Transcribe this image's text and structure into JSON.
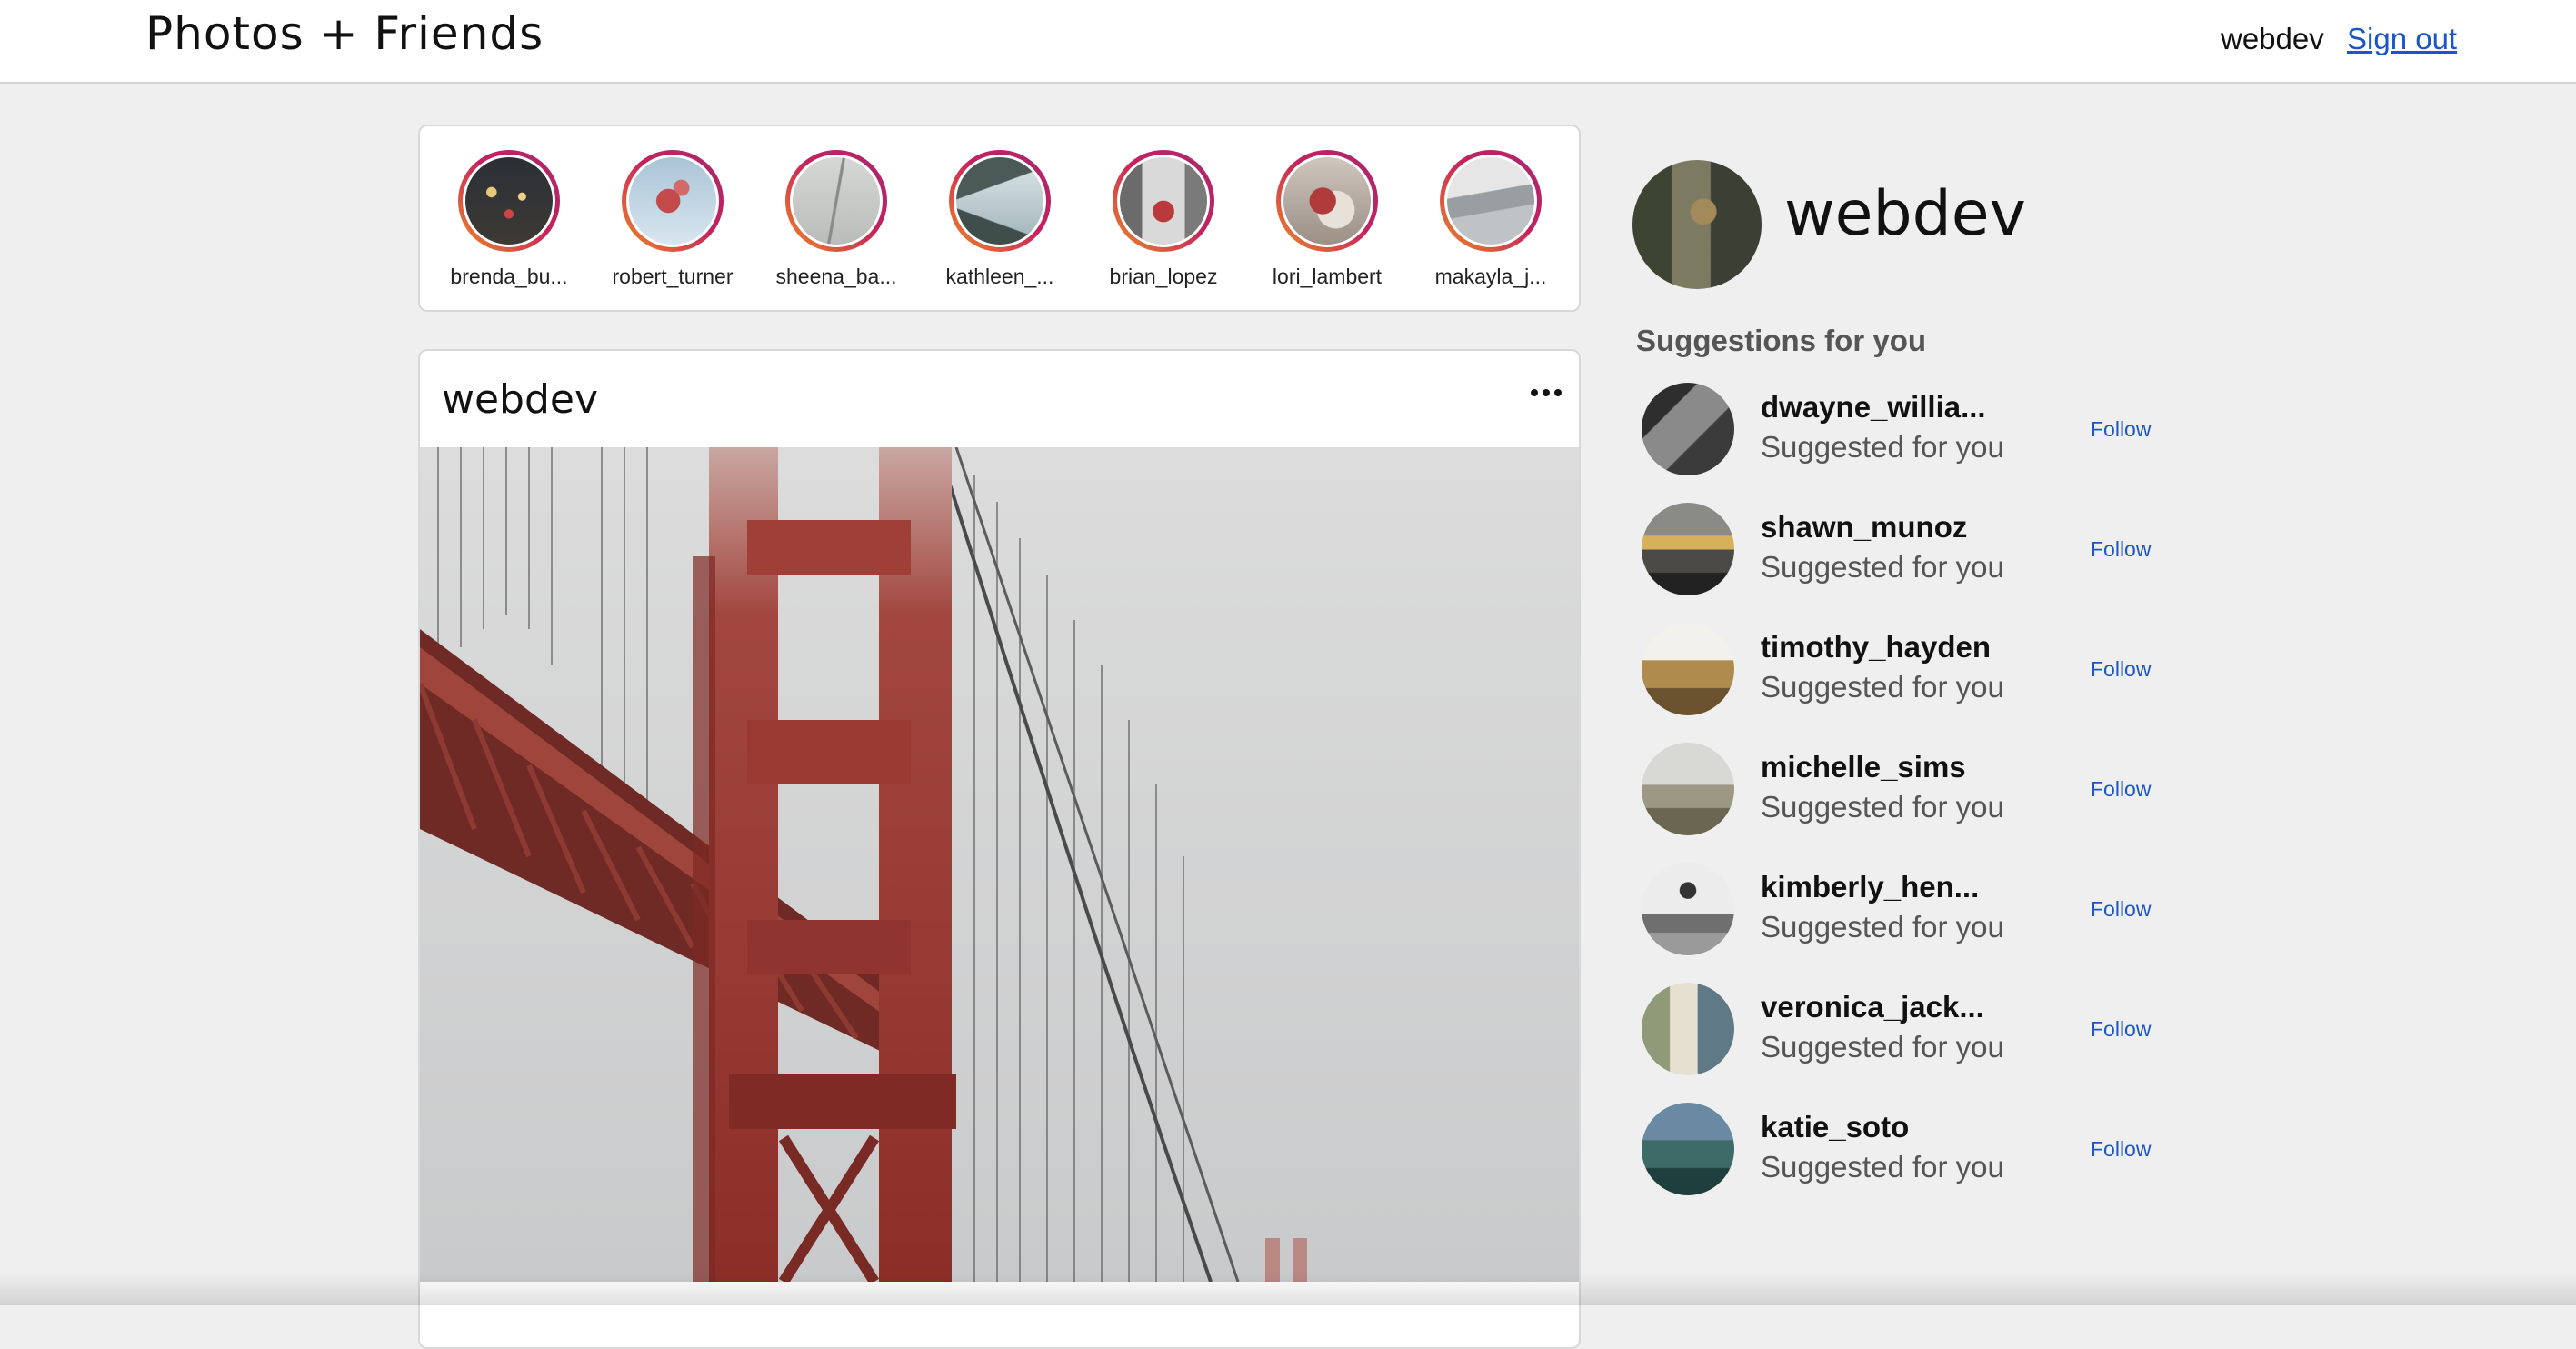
{
  "header": {
    "app_title": "Photos + Friends",
    "username": "webdev",
    "sign_out": "Sign out"
  },
  "stories": [
    {
      "name": "brenda_bu..."
    },
    {
      "name": "robert_turner"
    },
    {
      "name": "sheena_ba..."
    },
    {
      "name": "kathleen_..."
    },
    {
      "name": "brian_lopez"
    },
    {
      "name": "lori_lambert"
    },
    {
      "name": "makayla_j..."
    }
  ],
  "post": {
    "username": "webdev",
    "more_icon": "ellipsis-icon",
    "image_subject": "golden-gate-bridge-photo"
  },
  "profile": {
    "username": "webdev"
  },
  "suggestions": {
    "title": "Suggestions for you",
    "items": [
      {
        "name": "dwayne_willia...",
        "subtitle": "Suggested for you",
        "action": "Follow"
      },
      {
        "name": "shawn_munoz",
        "subtitle": "Suggested for you",
        "action": "Follow"
      },
      {
        "name": "timothy_hayden",
        "subtitle": "Suggested for you",
        "action": "Follow"
      },
      {
        "name": "michelle_sims",
        "subtitle": "Suggested for you",
        "action": "Follow"
      },
      {
        "name": "kimberly_hen...",
        "subtitle": "Suggested for you",
        "action": "Follow"
      },
      {
        "name": "veronica_jack...",
        "subtitle": "Suggested for you",
        "action": "Follow"
      },
      {
        "name": "katie_soto",
        "subtitle": "Suggested for you",
        "action": "Follow"
      }
    ]
  },
  "colors": {
    "link": "#1a56c9",
    "background": "#efefef",
    "story_ring_start": "#f08a24",
    "story_ring_end": "#c6205e"
  }
}
